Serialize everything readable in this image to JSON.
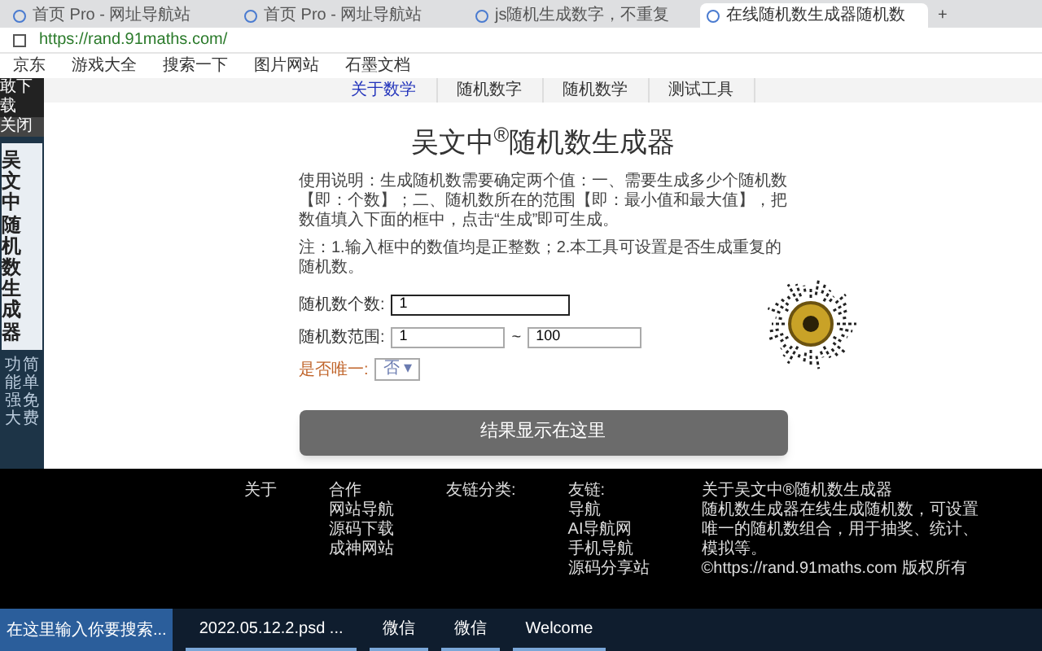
{
  "browser": {
    "tabs": [
      {
        "label": "首页 Pro - 网址导航站",
        "selected": false
      },
      {
        "label": "首页 Pro - 网址导航站",
        "selected": false
      },
      {
        "label": "js随机生成数字，不重复",
        "selected": false
      },
      {
        "label": "在线随机数生成器随机数",
        "selected": true
      }
    ],
    "new_tab": "+",
    "url": "https://rand.91maths.com/",
    "bookmarks": [
      "京东",
      "游戏大全",
      "搜索一下",
      "图片网站",
      "石墨文档"
    ]
  },
  "ad_panel": {
    "download": "敢下载",
    "close": "关闭",
    "title": "吴文中随机数生成器",
    "tagline": [
      "功能强大",
      "简单免费"
    ]
  },
  "nav": [
    {
      "label": "关于数学",
      "selected": true
    },
    {
      "label": "随机数字",
      "selected": false
    },
    {
      "label": "随机数学",
      "selected": false
    },
    {
      "label": "测试工具",
      "selected": false
    }
  ],
  "page": {
    "title": "吴文中$^{®}$随机数生成器",
    "description": [
      "使用说明：生成随机数需要确定两个值：一、需要生成多少个随机数【即：个数】；二、随机数所在的范围【即：最小值和最大值】，把数值填入下面的框中，点击“生成”即可生成。",
      "注：1.输入框中的数值均是正整数；2.本工具可设置是否生成重复的随机数。"
    ],
    "count_label": "随机数个数:",
    "count_value": "1",
    "range_label": "随机数范围:",
    "range_min": "1",
    "range_sep": "~",
    "range_max": "100",
    "unique_label": "是否唯一:",
    "unique_value": "否",
    "unique_caret": "▾",
    "result": "结果显示在这里"
  },
  "footer": {
    "about": "关于",
    "coop": {
      "title": "合作",
      "links": [
        "网站导航",
        "源码下载",
        "成神网站"
      ]
    },
    "categories": {
      "title": "友链分类:"
    },
    "friends": {
      "title": "友链:",
      "links": [
        "导航",
        "AI导航网",
        "手机导航",
        "源码分享站"
      ]
    },
    "intro": {
      "title": "关于吴文中®随机数生成器",
      "text": "随机数生成器在线生成随机数，可设置唯一的随机数组合，用于抽奖、统计、模拟等。",
      "copyright": "©https://rand.91maths.com 版权所有"
    }
  },
  "taskbar": {
    "search": "在这里输入你要搜索...",
    "items": [
      "2022.05.12.2.psd ...",
      "微信",
      "微信",
      "Welcome"
    ]
  }
}
